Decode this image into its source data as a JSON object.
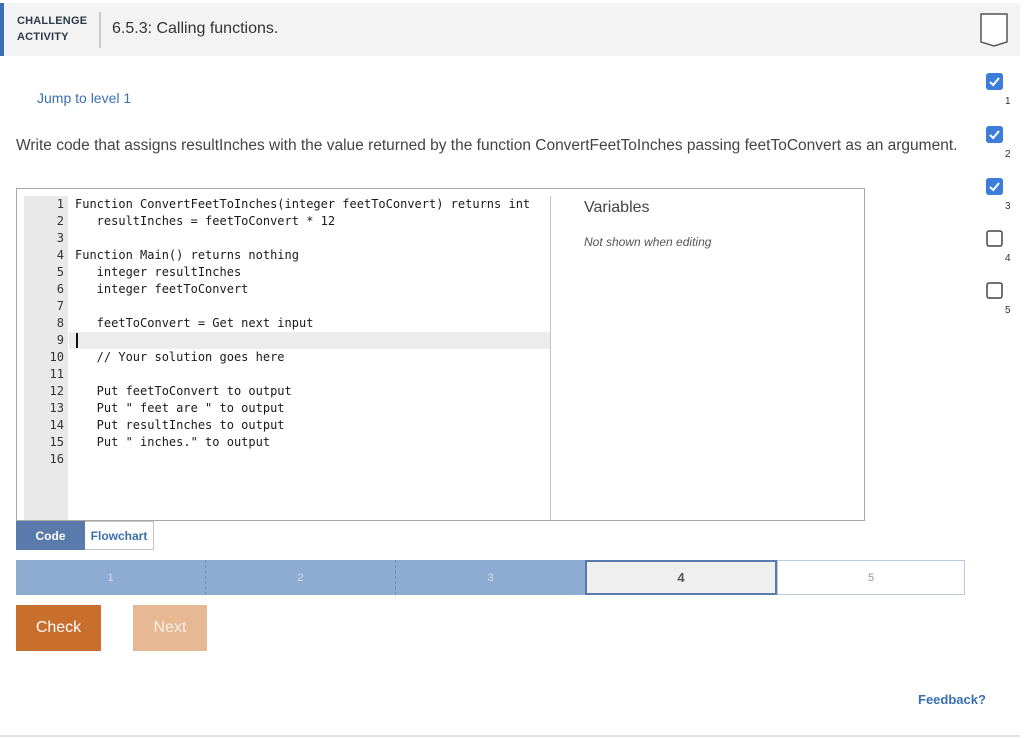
{
  "header": {
    "kicker_line1": "CHALLENGE",
    "kicker_line2": "ACTIVITY",
    "title": "6.5.3: Calling functions."
  },
  "jump_link": "Jump to level 1",
  "prompt": "Write code that assigns resultInches with the value returned by the function ConvertFeetToInches passing feetToConvert as an argument.",
  "editor": {
    "active_line": 9,
    "line_numbers": [
      "1",
      "2",
      "3",
      "4",
      "5",
      "6",
      "7",
      "8",
      "9",
      "10",
      "11",
      "12",
      "13",
      "14",
      "15",
      "16"
    ],
    "lines": [
      "Function ConvertFeetToInches(integer feetToConvert) returns int",
      "   resultInches = feetToConvert * 12",
      "",
      "Function Main() returns nothing",
      "   integer resultInches",
      "   integer feetToConvert",
      "",
      "   feetToConvert = Get next input",
      "",
      "   // Your solution goes here",
      "",
      "   Put feetToConvert to output",
      "   Put \" feet are \" to output",
      "   Put resultInches to output",
      "   Put \" inches.\" to output",
      ""
    ]
  },
  "variables": {
    "title": "Variables",
    "note": "Not shown when editing"
  },
  "tabs": {
    "code": "Code",
    "flowchart": "Flowchart",
    "selected": "code"
  },
  "progress": {
    "current_level": 4,
    "levels": [
      {
        "label": "1",
        "state": "done"
      },
      {
        "label": "2",
        "state": "done"
      },
      {
        "label": "3",
        "state": "done"
      },
      {
        "label": "4",
        "state": "current"
      },
      {
        "label": "5",
        "state": "todo"
      }
    ]
  },
  "buttons": {
    "check": "Check",
    "next": "Next"
  },
  "feedback": "Feedback?",
  "level_rail": [
    {
      "label": "1",
      "state": "done",
      "icon": "checkmark-icon"
    },
    {
      "label": "2",
      "state": "done",
      "icon": "checkmark-icon"
    },
    {
      "label": "3",
      "state": "done",
      "icon": "checkmark-icon"
    },
    {
      "label": "4",
      "state": "todo",
      "icon": "empty-box-icon"
    },
    {
      "label": "5",
      "state": "todo",
      "icon": "empty-box-icon"
    }
  ],
  "colors": {
    "accent_blue": "#3b6fb6",
    "check_orange": "#c96f2e",
    "next_orange_disabled": "#e6b894",
    "progress_done": "#8eacd2",
    "level_done": "#3b7dd8"
  }
}
